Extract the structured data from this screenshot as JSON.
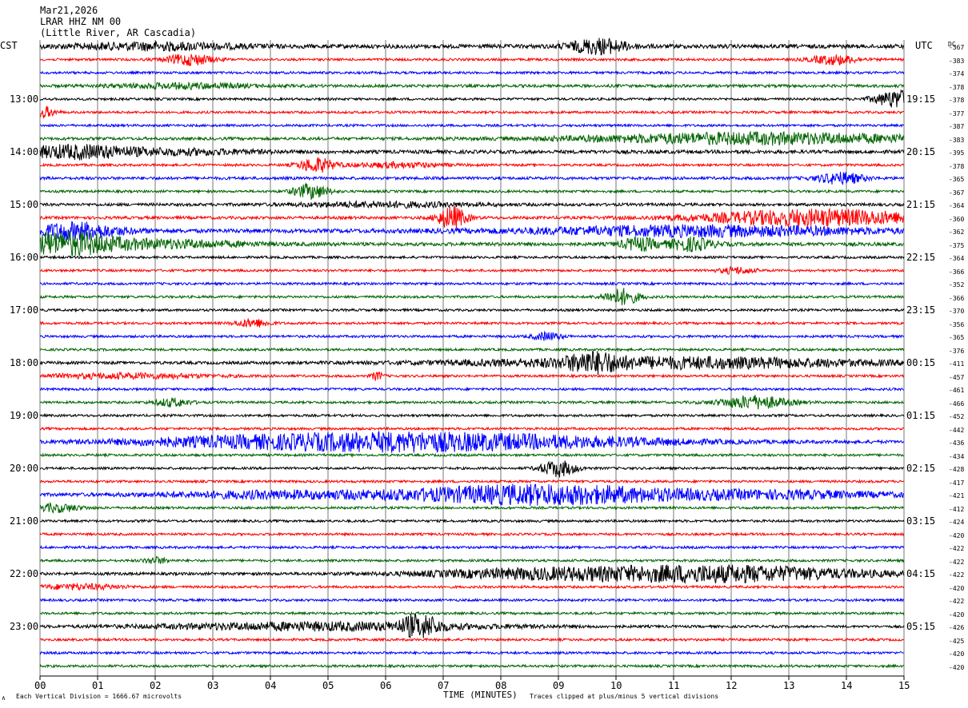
{
  "header": {
    "date": "Mar21,2026",
    "station": "LRAR HHZ NM 00",
    "location": "(Little River, AR Cascadia)",
    "left_tz": "CST",
    "right_tz": "UTC",
    "dc_label": "DC"
  },
  "footer": {
    "vertical_division": "Each Vertical Division = 1666.67 microvolts",
    "clip_note": "Traces clipped at plus/minus 5 vertical divisions",
    "corner_mark": "∧"
  },
  "chart_data": {
    "type": "line",
    "xlabel": "TIME (MINUTES)",
    "xlim": [
      0,
      15
    ],
    "x_ticks": [
      "00",
      "01",
      "02",
      "03",
      "04",
      "05",
      "06",
      "07",
      "08",
      "09",
      "10",
      "11",
      "12",
      "13",
      "14",
      "15"
    ],
    "left_hour_labels": [
      "13:00",
      "14:00",
      "15:00",
      "16:00",
      "17:00",
      "18:00",
      "19:00",
      "20:00",
      "21:00",
      "22:00",
      "23:00"
    ],
    "right_hour_labels": [
      "19:15",
      "20:15",
      "21:15",
      "22:15",
      "23:15",
      "00:15",
      "01:15",
      "02:15",
      "03:15",
      "04:15",
      "05:15"
    ],
    "trace_colors": [
      "#000000",
      "#ff0000",
      "#0000ff",
      "#006400"
    ],
    "grid": true,
    "traces": [
      {
        "dc": "-367",
        "noise": 2.5,
        "events": [
          [
            2.0,
            1.5,
            4
          ],
          [
            9.7,
            0.5,
            9
          ]
        ]
      },
      {
        "dc": "-383",
        "noise": 1.5,
        "events": [
          [
            2.6,
            0.4,
            7
          ],
          [
            13.8,
            0.4,
            6
          ]
        ]
      },
      {
        "dc": "-374",
        "noise": 1.5,
        "events": []
      },
      {
        "dc": "-378",
        "noise": 1.8,
        "events": [
          [
            2.5,
            1.2,
            3
          ]
        ]
      },
      {
        "dc": "-378",
        "noise": 1.5,
        "events": [
          [
            14.9,
            0.4,
            11
          ]
        ]
      },
      {
        "dc": "-377",
        "noise": 1.5,
        "events": [
          [
            0.05,
            0.2,
            7
          ]
        ]
      },
      {
        "dc": "-387",
        "noise": 1.5,
        "events": []
      },
      {
        "dc": "-383",
        "noise": 1.8,
        "events": [
          [
            12.5,
            3.0,
            7
          ]
        ]
      },
      {
        "dc": "-395",
        "noise": 2.2,
        "events": [
          [
            0.6,
            1.0,
            8
          ],
          [
            2.5,
            1.3,
            3
          ]
        ]
      },
      {
        "dc": "-378",
        "noise": 1.5,
        "events": [
          [
            4.8,
            0.3,
            9
          ],
          [
            6.2,
            0.8,
            3
          ]
        ]
      },
      {
        "dc": "-365",
        "noise": 1.8,
        "events": [
          [
            13.9,
            0.4,
            7
          ]
        ]
      },
      {
        "dc": "-367",
        "noise": 1.5,
        "events": [
          [
            4.7,
            0.3,
            9
          ]
        ]
      },
      {
        "dc": "-364",
        "noise": 1.8,
        "events": [
          [
            6.0,
            1.5,
            3
          ]
        ]
      },
      {
        "dc": "-360",
        "noise": 1.8,
        "events": [
          [
            7.15,
            0.25,
            14
          ],
          [
            13.5,
            2.0,
            10
          ]
        ]
      },
      {
        "dc": "-362",
        "noise": 2.5,
        "events": [
          [
            0.6,
            0.8,
            10
          ],
          [
            11.5,
            3.0,
            6
          ]
        ]
      },
      {
        "dc": "-375",
        "noise": 2.2,
        "events": [
          [
            0.4,
            0.8,
            14
          ],
          [
            2.0,
            1.5,
            5
          ],
          [
            10.4,
            0.3,
            8
          ],
          [
            11.3,
            0.4,
            8
          ]
        ]
      },
      {
        "dc": "-364",
        "noise": 1.5,
        "events": []
      },
      {
        "dc": "-366",
        "noise": 1.5,
        "events": [
          [
            12.1,
            0.3,
            4
          ]
        ]
      },
      {
        "dc": "-352",
        "noise": 1.5,
        "events": []
      },
      {
        "dc": "-366",
        "noise": 1.5,
        "events": [
          [
            10.1,
            0.3,
            10
          ]
        ]
      },
      {
        "dc": "-370",
        "noise": 1.5,
        "events": []
      },
      {
        "dc": "-356",
        "noise": 1.5,
        "events": [
          [
            3.7,
            0.3,
            5
          ]
        ]
      },
      {
        "dc": "-365",
        "noise": 1.5,
        "events": [
          [
            8.8,
            0.25,
            5
          ]
        ]
      },
      {
        "dc": "-376",
        "noise": 1.5,
        "events": []
      },
      {
        "dc": "-411",
        "noise": 1.8,
        "events": [
          [
            11.0,
            3.5,
            7
          ],
          [
            9.6,
            0.4,
            10
          ]
        ]
      },
      {
        "dc": "-457",
        "noise": 1.5,
        "events": [
          [
            5.85,
            0.1,
            5
          ],
          [
            1.5,
            1.5,
            3
          ]
        ]
      },
      {
        "dc": "-461",
        "noise": 1.5,
        "events": []
      },
      {
        "dc": "-466",
        "noise": 1.5,
        "events": [
          [
            2.3,
            0.3,
            5
          ],
          [
            12.4,
            0.6,
            8
          ]
        ]
      },
      {
        "dc": "-452",
        "noise": 1.5,
        "events": []
      },
      {
        "dc": "-442",
        "noise": 1.5,
        "events": []
      },
      {
        "dc": "-436",
        "noise": 2.0,
        "events": [
          [
            6.0,
            2.5,
            10
          ],
          [
            3.0,
            2.0,
            4
          ],
          [
            9.0,
            2.5,
            5
          ]
        ]
      },
      {
        "dc": "-434",
        "noise": 1.5,
        "events": []
      },
      {
        "dc": "-428",
        "noise": 1.5,
        "events": [
          [
            9.0,
            0.3,
            10
          ]
        ]
      },
      {
        "dc": "-417",
        "noise": 1.5,
        "events": []
      },
      {
        "dc": "-421",
        "noise": 2.0,
        "events": [
          [
            8.7,
            2.5,
            12
          ],
          [
            4.0,
            2.0,
            4
          ],
          [
            13.0,
            2.0,
            4
          ]
        ]
      },
      {
        "dc": "-412",
        "noise": 1.5,
        "events": [
          [
            0.3,
            0.4,
            5
          ]
        ]
      },
      {
        "dc": "-424",
        "noise": 1.5,
        "events": []
      },
      {
        "dc": "-420",
        "noise": 1.5,
        "events": []
      },
      {
        "dc": "-422",
        "noise": 1.5,
        "events": []
      },
      {
        "dc": "-422",
        "noise": 1.5,
        "events": [
          [
            2.0,
            0.2,
            4
          ]
        ]
      },
      {
        "dc": "-422",
        "noise": 1.8,
        "events": [
          [
            11.8,
            2.5,
            10
          ],
          [
            8.5,
            2.0,
            5
          ]
        ]
      },
      {
        "dc": "-420",
        "noise": 1.5,
        "events": [
          [
            0.7,
            0.8,
            3
          ]
        ]
      },
      {
        "dc": "-422",
        "noise": 1.5,
        "events": []
      },
      {
        "dc": "-420",
        "noise": 1.5,
        "events": []
      },
      {
        "dc": "-426",
        "noise": 1.5,
        "events": [
          [
            6.6,
            0.3,
            14
          ],
          [
            5.0,
            3.0,
            5
          ]
        ]
      },
      {
        "dc": "-425",
        "noise": 1.5,
        "events": []
      },
      {
        "dc": "-420",
        "noise": 1.5,
        "events": []
      },
      {
        "dc": "-420",
        "noise": 1.5,
        "events": []
      }
    ]
  }
}
